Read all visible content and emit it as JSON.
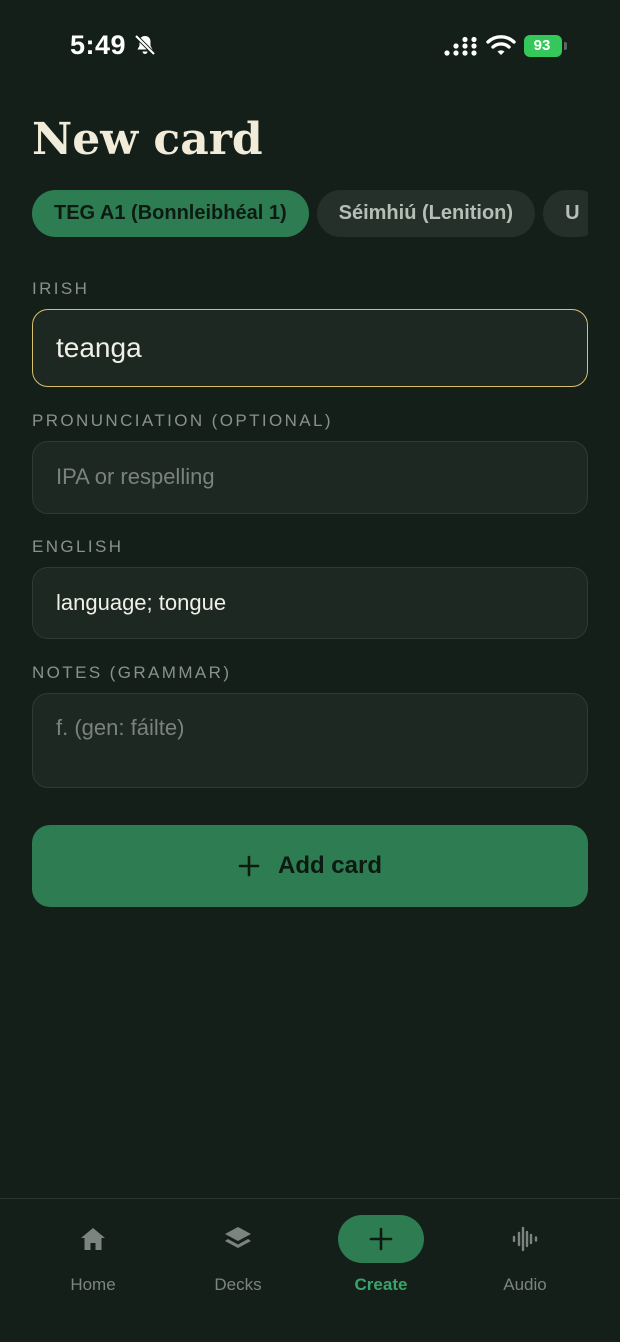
{
  "status_bar": {
    "time": "5:49",
    "battery_percent": "93",
    "icons": [
      "bell-slash-icon",
      "signal-icon",
      "wifi-icon",
      "battery-charging-icon"
    ]
  },
  "page": {
    "title": "New card"
  },
  "decks": [
    {
      "label": "TEG A1 (Bonnleibhéal 1)",
      "selected": true
    },
    {
      "label": "Séimhiú (Lenition)",
      "selected": false
    },
    {
      "label": "U",
      "selected": false
    }
  ],
  "form": {
    "irish": {
      "label": "IRISH",
      "value": "teanga",
      "placeholder": ""
    },
    "pronunciation": {
      "label": "PRONUNCIATION (OPTIONAL)",
      "value": "",
      "placeholder": "IPA or respelling"
    },
    "english": {
      "label": "ENGLISH",
      "value": "language; tongue",
      "placeholder": ""
    },
    "notes": {
      "label": "NOTES (GRAMMAR)",
      "value": "",
      "placeholder": "f. (gen: fáilte)"
    }
  },
  "add_button": {
    "label": "Add card",
    "icon": "plus-icon"
  },
  "nav": {
    "items": [
      {
        "label": "Home",
        "icon": "home-icon",
        "active": false
      },
      {
        "label": "Decks",
        "icon": "layers-icon",
        "active": false
      },
      {
        "label": "Create",
        "icon": "plus-icon",
        "active": true
      },
      {
        "label": "Audio",
        "icon": "waveform-icon",
        "active": false
      }
    ]
  },
  "colors": {
    "background": "#141f1a",
    "accent": "#2e7d52",
    "focus_border": "#d8c06c",
    "title": "#f1ecd9"
  }
}
